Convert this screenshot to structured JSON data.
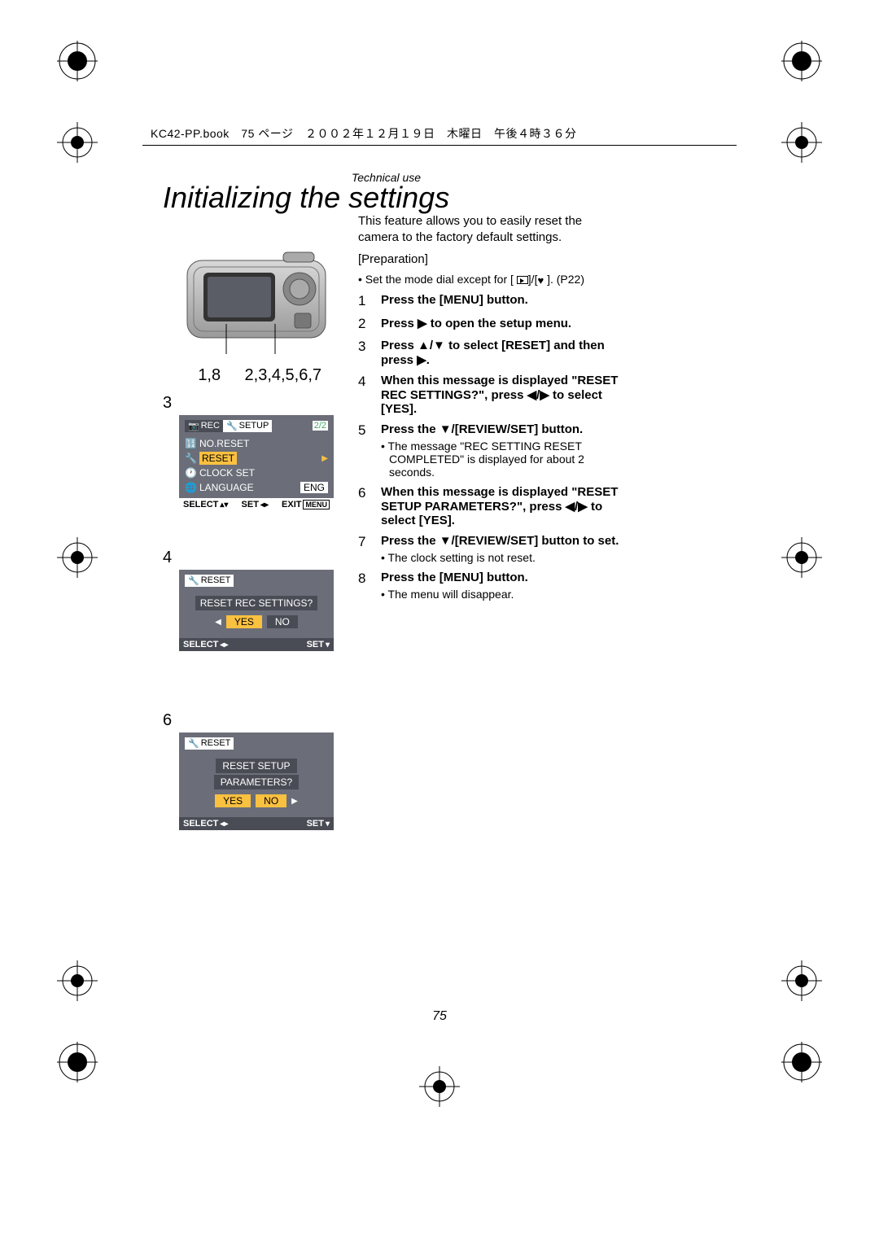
{
  "header": {
    "filename_line": "KC42-PP.book　75 ページ　２００２年１２月１９日　木曜日　午後４時３６分"
  },
  "section_label": "Technical use",
  "title": "Initializing the settings",
  "intro": "This feature allows you to easily reset the camera to the factory default settings.",
  "preparation_label": "[Preparation]",
  "preparation_bullet_prefix": "• Set the mode dial except for [",
  "preparation_bullet_suffix": "]. (P22)",
  "diagram_labels": {
    "left": "1,8",
    "right": "2,3,4,5,6,7"
  },
  "steps": [
    {
      "num": "1",
      "bold": "Press the [MENU] button."
    },
    {
      "num": "2",
      "bold": "Press ▶ to open the setup menu."
    },
    {
      "num": "3",
      "bold": "Press ▲/▼ to select [RESET] and then press ▶."
    },
    {
      "num": "4",
      "bold": "When this message is displayed \"RESET REC SETTINGS?\", press ◀/▶ to select [YES]."
    },
    {
      "num": "5",
      "bold": "Press the ▼/[REVIEW/SET] button.",
      "note": "The message \"REC SETTING RESET COMPLETED\" is displayed for about 2 seconds."
    },
    {
      "num": "6",
      "bold": "When this message is displayed \"RESET SETUP PARAMETERS?\", press ◀/▶ to select [YES]."
    },
    {
      "num": "7",
      "bold": "Press the ▼/[REVIEW/SET] button to set.",
      "note": "The clock setting is not reset."
    },
    {
      "num": "8",
      "bold": "Press the [MENU] button.",
      "note": "The menu will disappear."
    }
  ],
  "lcd3": {
    "label": "3",
    "tab_rec": "REC",
    "tab_setup": "SETUP",
    "page_indicator": "2/2",
    "items": {
      "no_reset": "NO.RESET",
      "reset": "RESET",
      "clock_set": "CLOCK SET",
      "language": "LANGUAGE",
      "language_value": "ENG"
    },
    "footer": {
      "select": "SELECT",
      "set": "SET",
      "exit": "EXIT",
      "menu": "MENU"
    }
  },
  "lcd4": {
    "label": "4",
    "title": "RESET",
    "question": "RESET REC SETTINGS?",
    "yes": "YES",
    "no": "NO",
    "footer": {
      "select": "SELECT",
      "set": "SET"
    }
  },
  "lcd6": {
    "label": "6",
    "title": "RESET",
    "question_line1": "RESET SETUP",
    "question_line2": "PARAMETERS?",
    "yes": "YES",
    "no": "NO",
    "footer": {
      "select": "SELECT",
      "set": "SET"
    }
  },
  "page_number": "75"
}
